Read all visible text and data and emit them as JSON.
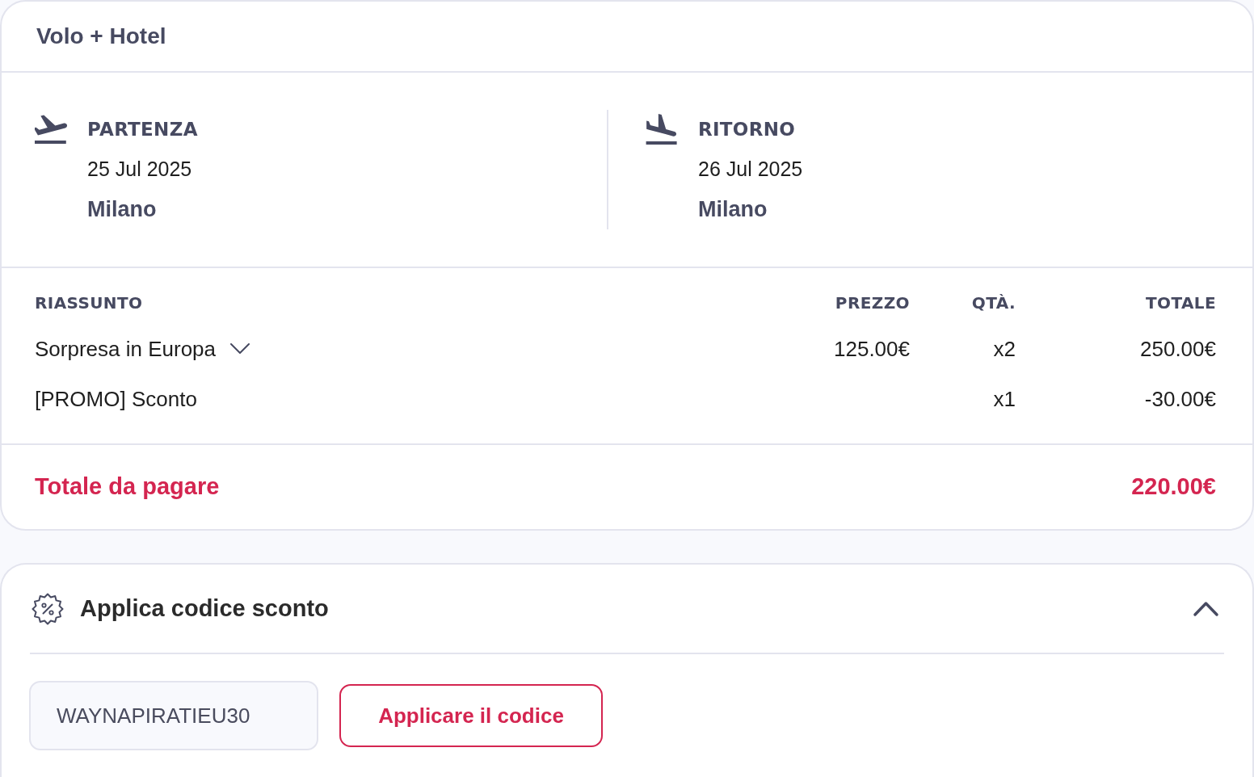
{
  "card_title": "Volo + Hotel",
  "flights": [
    {
      "kind": "departure",
      "label": "PARTENZA",
      "date": "25 Jul 2025",
      "city": "Milano"
    },
    {
      "kind": "return",
      "label": "RITORNO",
      "date": "26 Jul 2025",
      "city": "Milano"
    }
  ],
  "summary": {
    "columns": [
      "RIASSUNTO",
      "PREZZO",
      "QTÀ.",
      "TOTALE"
    ],
    "rows": [
      {
        "name": "Sorpresa in Europa",
        "expanded": false,
        "price": "125.00€",
        "qty": "x2",
        "total": "250.00€"
      },
      {
        "name": "[PROMO] Sconto",
        "qty": "x1",
        "total": "-30.00€"
      }
    ]
  },
  "grand_total": {
    "label": "Totale da pagare",
    "value": "220.00€"
  },
  "discount": {
    "title": "Applica codice sconto",
    "expanded": true,
    "code_field": {
      "value": "WAYNAPIRATIEU30"
    },
    "button": "Applicare il codice"
  }
}
